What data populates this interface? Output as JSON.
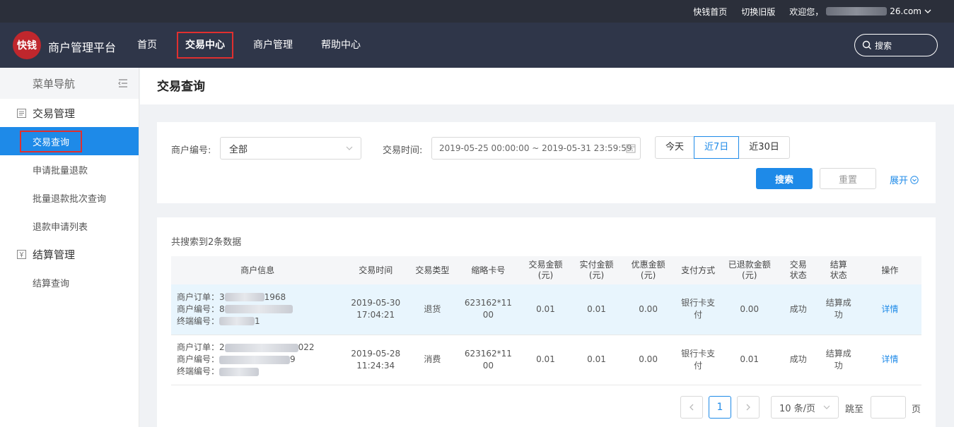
{
  "topbar": {
    "home_link": "快钱首页",
    "old_version": "切换旧版",
    "welcome": "欢迎您，",
    "user_suffix": "26.com"
  },
  "navbar": {
    "logo_text": "快钱",
    "brand": "商户管理平台",
    "items": [
      {
        "label": "首页"
      },
      {
        "label": "交易中心"
      },
      {
        "label": "商户管理"
      },
      {
        "label": "帮助中心"
      }
    ],
    "search_placeholder": "搜索"
  },
  "sidebar": {
    "header": "菜单导航",
    "groups": [
      {
        "label": "交易管理",
        "items": [
          "交易查询",
          "申请批量退款",
          "批量退款批次查询",
          "退款申请列表"
        ]
      },
      {
        "label": "结算管理",
        "items": [
          "结算查询"
        ]
      }
    ]
  },
  "page": {
    "title": "交易查询"
  },
  "filter": {
    "merchant_label": "商户编号:",
    "merchant_value": "全部",
    "time_label": "交易时间:",
    "time_value": "2019-05-25 00:00:00 ~ 2019-05-31 23:59:59",
    "ranges": [
      "今天",
      "近7日",
      "近30日"
    ],
    "selected_range": "近7日",
    "search_btn": "搜索",
    "reset_btn": "重置",
    "expand": "展开"
  },
  "results": {
    "count_text": "共搜索到2条数据",
    "headers": {
      "info": "商户信息",
      "time": "交易时间",
      "type": "交易类型",
      "card": "缩略卡号",
      "amount": "交易金额(元)",
      "paid": "实付金额(元)",
      "discount": "优惠金额(元)",
      "method": "支付方式",
      "refunded": "已退款金额(元)",
      "status": "交易状态",
      "settle": "结算状态",
      "op": "操作"
    },
    "rows": [
      {
        "order_label": "商户订单：",
        "order_pre": "3",
        "order_post": "1968",
        "merchant_label": "商户编号：",
        "merchant_pre": "8",
        "merchant_post": "",
        "terminal_label": "终端编号：",
        "terminal_post": "1",
        "date": "2019-05-30",
        "time": "17:04:21",
        "type": "退货",
        "card_a": "623162*11",
        "card_b": "00",
        "amount": "0.01",
        "paid": "0.01",
        "discount": "0.00",
        "method_a": "银行卡支",
        "method_b": "付",
        "refunded": "0.00",
        "status": "成功",
        "settle_a": "结算成",
        "settle_b": "功",
        "op": "详情"
      },
      {
        "order_label": "商户订单：",
        "order_pre": "2",
        "order_post": "022",
        "merchant_label": "商户编号：",
        "merchant_pre": "",
        "merchant_post": "9",
        "terminal_label": "终端编号：",
        "terminal_post": "",
        "date": "2019-05-28",
        "time": "11:24:34",
        "type": "消费",
        "card_a": "623162*11",
        "card_b": "00",
        "amount": "0.01",
        "paid": "0.01",
        "discount": "0.00",
        "method_a": "银行卡支",
        "method_b": "付",
        "refunded": "0.01",
        "status": "成功",
        "settle_a": "结算成",
        "settle_b": "功",
        "op": "详情"
      }
    ]
  },
  "pagination": {
    "current": "1",
    "page_size": "10 条/页",
    "jump_label": "跳至",
    "page_unit": "页"
  },
  "colors": {
    "accent": "#1e8ae8",
    "nav_bg": "#2f3649",
    "topbar_bg": "#2b2f3a",
    "highlight_box": "#e02f2f"
  }
}
